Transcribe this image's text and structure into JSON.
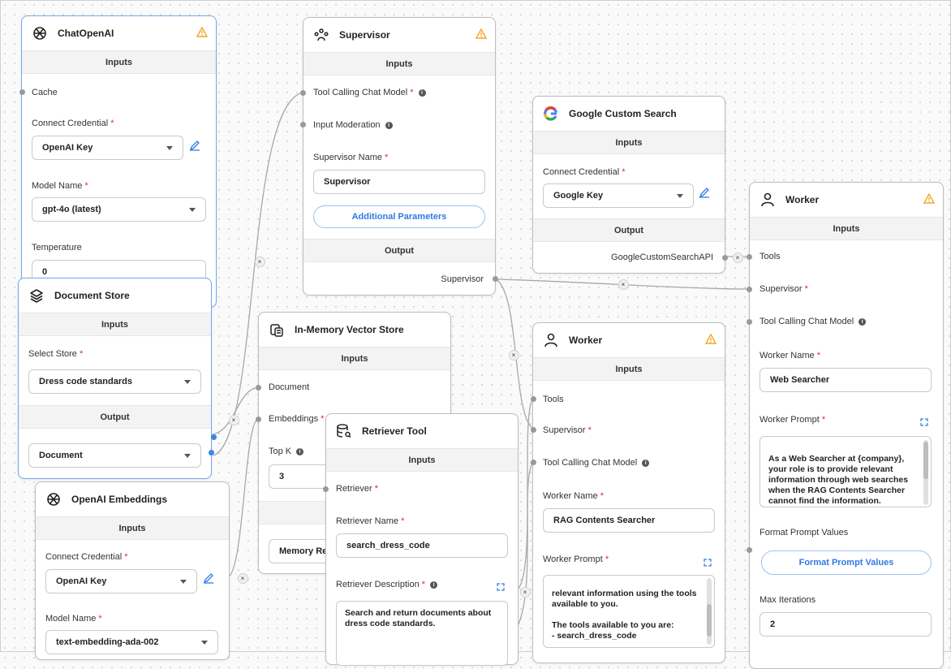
{
  "nodes": {
    "chatopenai": {
      "title": "ChatOpenAI",
      "inputs_label": "Inputs",
      "cache_label": "Cache",
      "credential_label": "Connect Credential",
      "credential_value": "OpenAI Key",
      "model_label": "Model Name",
      "model_value": "gpt-4o (latest)",
      "temperature_label": "Temperature",
      "temperature_value": "0"
    },
    "document_store": {
      "title": "Document Store",
      "inputs_label": "Inputs",
      "select_label": "Select Store",
      "select_value": "Dress code standards",
      "output_label": "Output",
      "output_value": "Document"
    },
    "openai_embeddings": {
      "title": "OpenAI Embeddings",
      "inputs_label": "Inputs",
      "credential_label": "Connect Credential",
      "credential_value": "OpenAI Key",
      "model_label": "Model Name",
      "model_value": "text-embedding-ada-002"
    },
    "supervisor": {
      "title": "Supervisor",
      "inputs_label": "Inputs",
      "tool_model_label": "Tool Calling Chat Model",
      "moderation_label": "Input Moderation",
      "name_label": "Supervisor Name",
      "name_value": "Supervisor",
      "additional_params": "Additional Parameters",
      "output_label": "Output",
      "output_value": "Supervisor"
    },
    "vector_store": {
      "title": "In-Memory Vector Store",
      "inputs_label": "Inputs",
      "document_label": "Document",
      "embeddings_label": "Embeddings",
      "topk_label": "Top K",
      "topk_value": "3",
      "output_value": "Memory Ret"
    },
    "retriever_tool": {
      "title": "Retriever Tool",
      "inputs_label": "Inputs",
      "retriever_label": "Retriever",
      "name_label": "Retriever Name",
      "name_value": "search_dress_code",
      "desc_label": "Retriever Description",
      "desc_value": "Search and return documents about dress code standards."
    },
    "google_search": {
      "title": "Google Custom Search",
      "inputs_label": "Inputs",
      "credential_label": "Connect Credential",
      "credential_value": "Google Key",
      "output_label": "Output",
      "output_value": "GoogleCustomSearchAPI"
    },
    "worker_rag": {
      "title": "Worker",
      "inputs_label": "Inputs",
      "tools_label": "Tools",
      "supervisor_label": "Supervisor",
      "tool_model_label": "Tool Calling Chat Model",
      "name_label": "Worker Name",
      "name_value": "RAG Contents Searcher",
      "prompt_label": "Worker Prompt",
      "prompt_value": "relevant information using the tools available to you.\n\nThe tools available to you are:\n- search_dress_code"
    },
    "worker_web": {
      "title": "Worker",
      "inputs_label": "Inputs",
      "tools_label": "Tools",
      "supervisor_label": "Supervisor",
      "tool_model_label": "Tool Calling Chat Model",
      "name_label": "Worker Name",
      "name_value": "Web Searcher",
      "prompt_label": "Worker Prompt",
      "prompt_value": "As a Web Searcher at {company}, your role is to provide relevant information through web searches when the RAG Contents Searcher cannot find the information.",
      "format_label": "Format Prompt Values",
      "format_button": "Format Prompt Values",
      "iterations_label": "Max Iterations",
      "iterations_value": "2"
    }
  },
  "edge_delete_glyph": "×",
  "required_mark": "*",
  "info_glyph": "i",
  "colors": {
    "accent": "#2f7ae5",
    "warning": "#f5a623",
    "required": "#d32f2f",
    "selected_border": "#74a7f0"
  }
}
